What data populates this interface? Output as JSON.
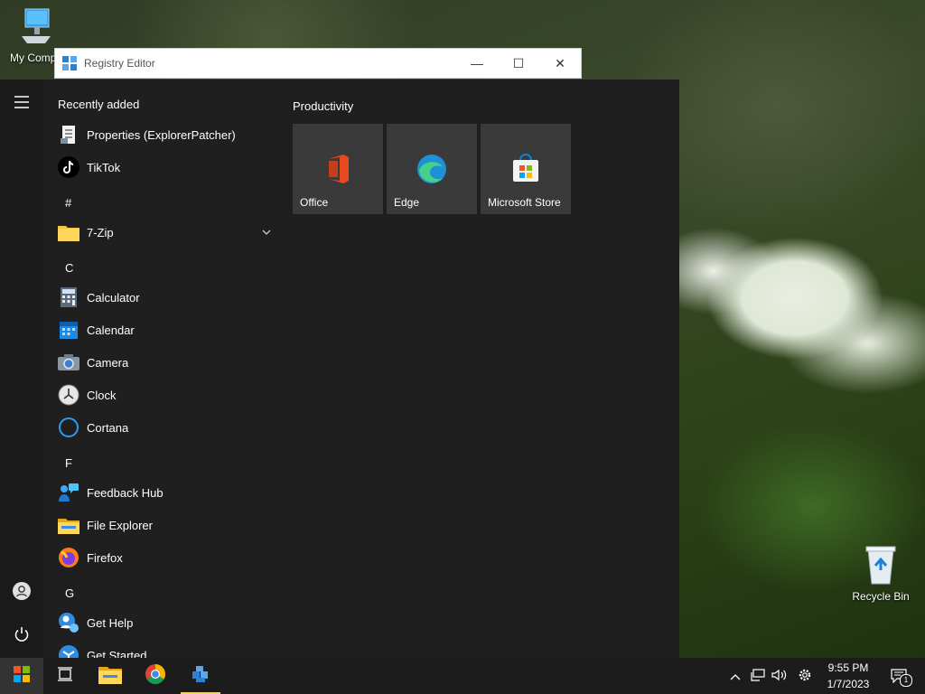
{
  "desktop": {
    "icons": [
      {
        "label": "My Compu"
      },
      {
        "label": "Recycle Bin"
      }
    ]
  },
  "window": {
    "title": "Registry Editor",
    "minimize": "—",
    "maximize": "☐",
    "close": "✕"
  },
  "start_menu": {
    "recently_added_label": "Recently added",
    "recent": [
      {
        "label": "Properties (ExplorerPatcher)",
        "icon": "properties-icon"
      },
      {
        "label": "TikTok",
        "icon": "tiktok-icon"
      }
    ],
    "sections": [
      {
        "letter": "#",
        "apps": [
          {
            "label": "7-Zip",
            "icon": "folder-icon",
            "expandable": true
          }
        ]
      },
      {
        "letter": "C",
        "apps": [
          {
            "label": "Calculator",
            "icon": "calculator-icon"
          },
          {
            "label": "Calendar",
            "icon": "calendar-icon"
          },
          {
            "label": "Camera",
            "icon": "camera-icon"
          },
          {
            "label": "Clock",
            "icon": "clock-icon"
          },
          {
            "label": "Cortana",
            "icon": "cortana-icon"
          }
        ]
      },
      {
        "letter": "F",
        "apps": [
          {
            "label": "Feedback Hub",
            "icon": "feedback-hub-icon"
          },
          {
            "label": "File Explorer",
            "icon": "folder-icon"
          },
          {
            "label": "Firefox",
            "icon": "firefox-icon"
          }
        ]
      },
      {
        "letter": "G",
        "apps": [
          {
            "label": "Get Help",
            "icon": "get-help-icon"
          },
          {
            "label": "Get Started",
            "icon": "get-started-icon"
          }
        ]
      }
    ],
    "tile_group": {
      "title": "Productivity",
      "tiles": [
        {
          "label": "Office",
          "icon": "office-icon"
        },
        {
          "label": "Edge",
          "icon": "edge-icon"
        },
        {
          "label": "Microsoft Store",
          "icon": "store-icon"
        }
      ]
    }
  },
  "taskbar": {
    "clock_time": "9:55 PM",
    "clock_date": "1/7/2023",
    "notification_count": "1",
    "tray_chevron": "^",
    "accent": "#f0d268"
  }
}
